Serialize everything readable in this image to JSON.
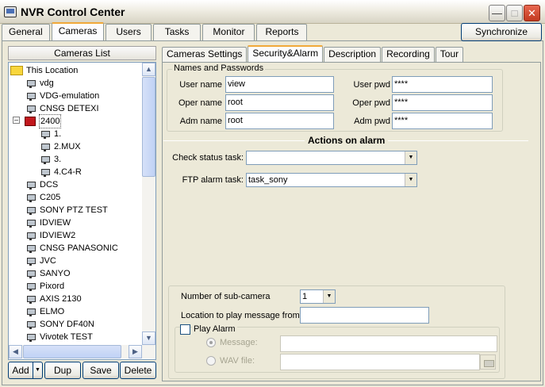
{
  "window": {
    "title": "NVR Control Center"
  },
  "main_tabs": [
    "General",
    "Cameras",
    "Users",
    "Tasks",
    "Monitor",
    "Reports"
  ],
  "active_main_tab": "Cameras",
  "synchronize_label": "Synchronize",
  "cameras_list": {
    "header": "Cameras List",
    "items": [
      {
        "label": "This Location",
        "type": "folder",
        "level": 0
      },
      {
        "label": "vdg",
        "type": "camera",
        "level": 1
      },
      {
        "label": "VDG-emulation",
        "type": "camera",
        "level": 1
      },
      {
        "label": "CNSG DETEXI",
        "type": "camera",
        "level": 1
      },
      {
        "label": "2400",
        "type": "nvr",
        "level": 1,
        "expanded": true,
        "selected": true
      },
      {
        "label": "1.",
        "type": "camera",
        "level": 2
      },
      {
        "label": "2.MUX",
        "type": "camera",
        "level": 2
      },
      {
        "label": "3.",
        "type": "camera",
        "level": 2
      },
      {
        "label": "4.C4-R",
        "type": "camera",
        "level": 2
      },
      {
        "label": "DCS",
        "type": "camera",
        "level": 1
      },
      {
        "label": "C205",
        "type": "camera",
        "level": 1
      },
      {
        "label": "SONY PTZ TEST",
        "type": "camera",
        "level": 1
      },
      {
        "label": "IDVIEW",
        "type": "camera",
        "level": 1
      },
      {
        "label": "IDVIEW2",
        "type": "camera",
        "level": 1
      },
      {
        "label": "CNSG PANASONIC",
        "type": "camera",
        "level": 1
      },
      {
        "label": "JVC",
        "type": "camera",
        "level": 1
      },
      {
        "label": "SANYO",
        "type": "camera",
        "level": 1
      },
      {
        "label": "Pixord",
        "type": "camera",
        "level": 1
      },
      {
        "label": "AXIS 2130",
        "type": "camera",
        "level": 1
      },
      {
        "label": "ELMO",
        "type": "camera",
        "level": 1
      },
      {
        "label": "SONY DF40N",
        "type": "camera",
        "level": 1
      },
      {
        "label": "Vivotek TEST",
        "type": "camera",
        "level": 1
      }
    ],
    "buttons": {
      "add": "Add",
      "dup": "Dup",
      "save": "Save",
      "delete": "Delete"
    }
  },
  "sub_tabs": [
    "Cameras Settings",
    "Security&Alarm",
    "Description",
    "Recording",
    "Tour"
  ],
  "active_sub_tab": "Security&Alarm",
  "names_passwords": {
    "title": "Names and Passwords",
    "user_name_label": "User name",
    "user_name": "view",
    "oper_name_label": "Oper name",
    "oper_name": "root",
    "adm_name_label": "Adm name",
    "adm_name": "root",
    "user_pwd_label": "User pwd",
    "user_pwd": "****",
    "oper_pwd_label": "Oper pwd",
    "oper_pwd": "****",
    "adm_pwd_label": "Adm pwd",
    "adm_pwd": "****"
  },
  "actions_on_alarm": {
    "heading": "Actions on alarm",
    "check_status_label": "Check status task:",
    "check_status_value": "",
    "ftp_alarm_label": "FTP alarm task:",
    "ftp_alarm_value": "task_sony"
  },
  "sub_camera": {
    "count_label": "Number of sub-camera",
    "count_value": "1",
    "location_label": "Location to play message from:",
    "location_value": ""
  },
  "play_alarm": {
    "label": "Play Alarm",
    "checked": false,
    "message_label": "Message:",
    "message_value": "",
    "wav_label": "WAV file:",
    "wav_value": ""
  }
}
